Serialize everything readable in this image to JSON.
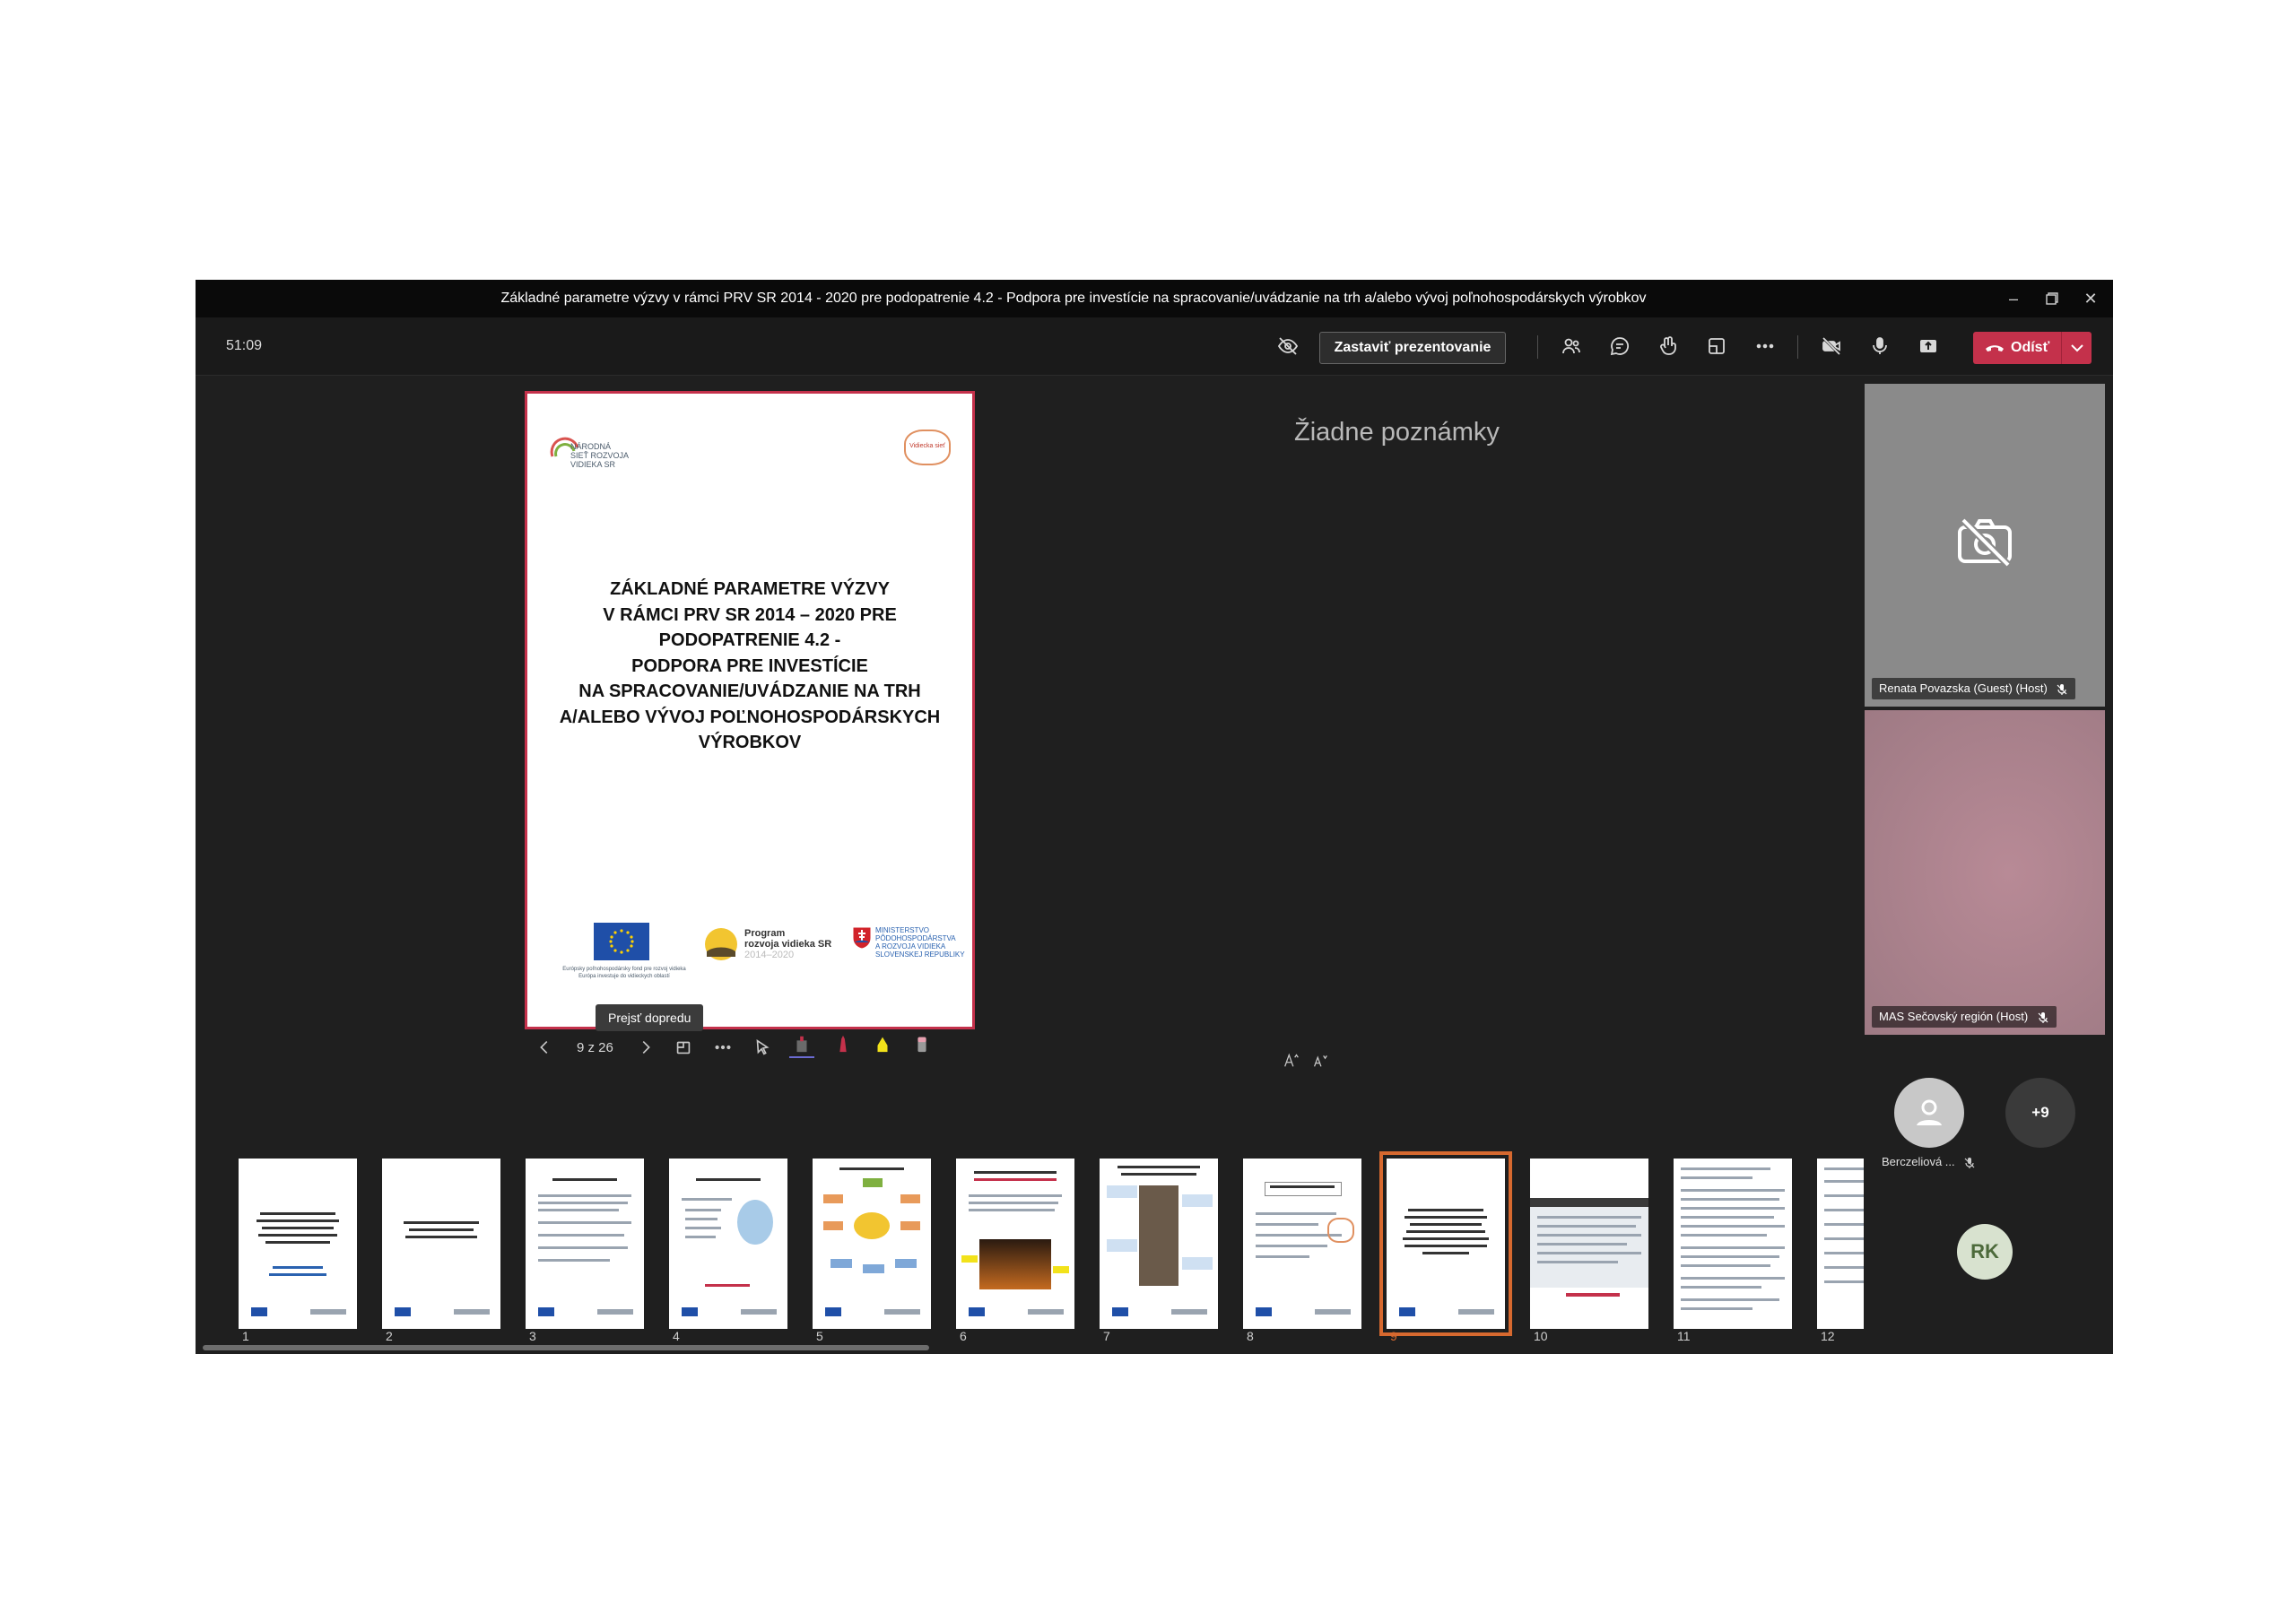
{
  "window": {
    "title": "Základné parametre výzvy v rámci PRV SR 2014 - 2020 pre podopatrenie 4.2 - Podpora pre investície na spracovanie/uvádzanie na trh a/alebo vývoj poľnohospodárskych výrobkov",
    "controls": [
      "minimize-icon",
      "restore-icon",
      "close-icon"
    ]
  },
  "toolbar": {
    "timer": "51:09",
    "stop_presenting_label": "Zastaviť prezentovanie",
    "leave_label": "Odísť",
    "icons": [
      "hide-icon",
      "participants-icon",
      "chat-icon",
      "reactions-icon",
      "rooms-icon",
      "more-icon",
      "camera-off-icon",
      "microphone-icon",
      "share-icon"
    ],
    "accent": "#c4314b"
  },
  "slide": {
    "title_lines": [
      "ZÁKLADNÉ PARAMETRE VÝZVY",
      "V RÁMCI PRV SR 2014 – 2020 PRE",
      "PODOPATRENIE 4.2 -",
      "PODPORA PRE INVESTÍCIE",
      "NA SPRACOVANIE/UVÁDZANIE NA TRH",
      "A/ALEBO VÝVOJ POĽNOHOSPODÁRSKYCH",
      "VÝROBKOV"
    ],
    "logo_top_left": [
      "NÁRODNÁ",
      "SIEŤ ROZVOJA",
      "VIDIEKA SR"
    ],
    "logo_top_right": "Vidiecka sieť",
    "eu_caption": [
      "Európsky poľnohospodársky fond pre rozvoj vidieka",
      "Európa investuje do vidieckych oblastí"
    ],
    "program_logo": [
      "Program",
      "rozvoja vidieka SR",
      "2014–2020"
    ],
    "ministry_logo": [
      "MINISTERSTVO",
      "PÔDOHOSPODÁRSTVA",
      "A ROZVOJA VIDIEKA",
      "SLOVENSKEJ REPUBLIKY"
    ]
  },
  "notes": {
    "empty_text": "Žiadne poznámky"
  },
  "controls": {
    "tooltip": "Prejsť dopredu",
    "counter": "9 z 26"
  },
  "filmstrip": {
    "selected_index": 9,
    "thumbnails": [
      "1",
      "2",
      "3",
      "4",
      "5",
      "6",
      "7",
      "8",
      "9",
      "10",
      "11",
      "12"
    ],
    "accent": "#d7692f"
  },
  "participants": {
    "tiles": [
      {
        "name": "Renata Povazska (Guest) (Host)",
        "camera": "off",
        "bg": "#8a8a8a"
      },
      {
        "name": "MAS Sečovský región (Host)",
        "camera": "on",
        "bg": "#b08690"
      }
    ],
    "small": [
      {
        "name": "Berczeliová ..."
      },
      {
        "count": "+9"
      }
    ],
    "self_initials": "RK"
  }
}
